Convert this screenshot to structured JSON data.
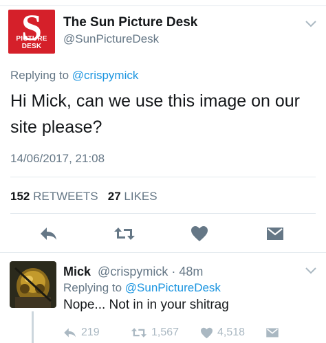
{
  "main_tweet": {
    "avatar_text": "PICTURE DESK",
    "avatar_letter": "S",
    "display_name": "The Sun Picture Desk",
    "handle": "@SunPictureDesk",
    "replying_prefix": "Replying to ",
    "replying_to": "@crispymick",
    "text": "Hi Mick, can we use this image on our site please?",
    "timestamp": "14/06/2017, 21:08",
    "retweets_count": "152",
    "retweets_label": "RETWEETS",
    "likes_count": "27",
    "likes_label": "LIKES"
  },
  "reply_tweet": {
    "display_name": "Mick",
    "handle": "@crispymick",
    "separator": " · ",
    "time_ago": "48m",
    "replying_prefix": "Replying to ",
    "replying_to": "@SunPictureDesk",
    "text": "Nope... Not in in your shitrag",
    "reply_count": "219",
    "retweet_count": "1,567",
    "like_count": "4,518"
  },
  "colors": {
    "brand_red": "#d5202a",
    "link_blue": "#1b95e0",
    "muted_gray": "#657786",
    "icon_gray": "#657786",
    "faded_icon_gray": "#aab8c2"
  },
  "icons": [
    "reply-icon",
    "retweet-icon",
    "heart-icon",
    "direct-message-icon",
    "chevron-down-icon"
  ]
}
